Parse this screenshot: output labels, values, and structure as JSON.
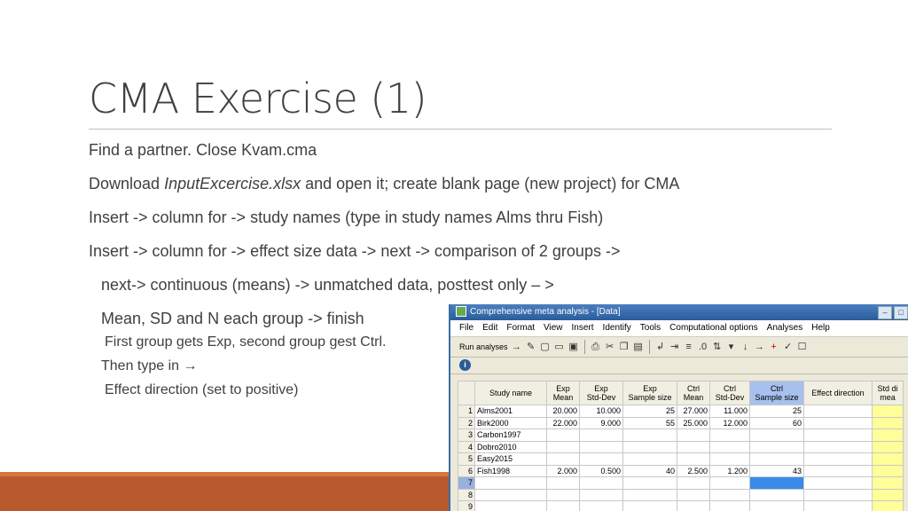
{
  "slide": {
    "title": "CMA Exercise (1)",
    "lines": [
      "Find a partner.  Close Kvam.cma",
      "Insert -> column for -> study names (type in study names Alms thru Fish)",
      "Insert -> column for -> effect size data -> next -> comparison of 2 groups ->",
      "next-> continuous (means) -> unmatched data, posttest only – >",
      "Mean, SD and N each group -> finish",
      "First group gets Exp, second group gest Ctrl.",
      "Then type in",
      "Effect direction (set to positive)"
    ],
    "download": {
      "prefix": "Download ",
      "filename": "InputExcercise.xlsx",
      "suffix": " and open it; create blank page (new project) for CMA"
    },
    "arrow_glyph": "→"
  },
  "cma_window": {
    "title": "Comprehensive meta analysis - [Data]",
    "menu": [
      "File",
      "Edit",
      "Format",
      "View",
      "Insert",
      "Identify",
      "Tools",
      "Computational options",
      "Analyses",
      "Help"
    ],
    "run_button": "Run analyses",
    "columns": [
      "Study name",
      "Exp\nMean",
      "Exp\nStd-Dev",
      "Exp\nSample size",
      "Ctrl\nMean",
      "Ctrl\nStd-Dev",
      "Ctrl\nSample size",
      "Effect direction",
      "Std di\nmea"
    ],
    "rows": [
      {
        "n": "1",
        "study": "Alms2001",
        "exp_mean": "20.000",
        "exp_sd": "10.000",
        "exp_n": "25",
        "ctrl_mean": "27.000",
        "ctrl_sd": "11.000",
        "ctrl_n": "25"
      },
      {
        "n": "2",
        "study": "Birk2000",
        "exp_mean": "22.000",
        "exp_sd": "9.000",
        "exp_n": "55",
        "ctrl_mean": "25.000",
        "ctrl_sd": "12.000",
        "ctrl_n": "60"
      },
      {
        "n": "3",
        "study": "Carbon1997",
        "exp_mean": "",
        "exp_sd": "",
        "exp_n": "",
        "ctrl_mean": "",
        "ctrl_sd": "",
        "ctrl_n": ""
      },
      {
        "n": "4",
        "study": "Dobro2010",
        "exp_mean": "",
        "exp_sd": "",
        "exp_n": "",
        "ctrl_mean": "",
        "ctrl_sd": "",
        "ctrl_n": ""
      },
      {
        "n": "5",
        "study": "Easy2015",
        "exp_mean": "",
        "exp_sd": "",
        "exp_n": "",
        "ctrl_mean": "",
        "ctrl_sd": "",
        "ctrl_n": ""
      },
      {
        "n": "6",
        "study": "Fish1998",
        "exp_mean": "2.000",
        "exp_sd": "0.500",
        "exp_n": "40",
        "ctrl_mean": "2.500",
        "ctrl_sd": "1.200",
        "ctrl_n": "43"
      },
      {
        "n": "7",
        "study": "",
        "exp_mean": "",
        "exp_sd": "",
        "exp_n": "",
        "ctrl_mean": "",
        "ctrl_sd": "",
        "ctrl_n": ""
      },
      {
        "n": "8",
        "study": "",
        "exp_mean": "",
        "exp_sd": "",
        "exp_n": "",
        "ctrl_mean": "",
        "ctrl_sd": "",
        "ctrl_n": ""
      },
      {
        "n": "9",
        "study": "",
        "exp_mean": "",
        "exp_sd": "",
        "exp_n": "",
        "ctrl_mean": "",
        "ctrl_sd": "",
        "ctrl_n": ""
      }
    ]
  },
  "colors": {
    "accent_bar": "#b85a2e",
    "highlight_column": "#a8c0ee",
    "std_column": "#ffff99",
    "selected_cell": "#3a8be8"
  }
}
